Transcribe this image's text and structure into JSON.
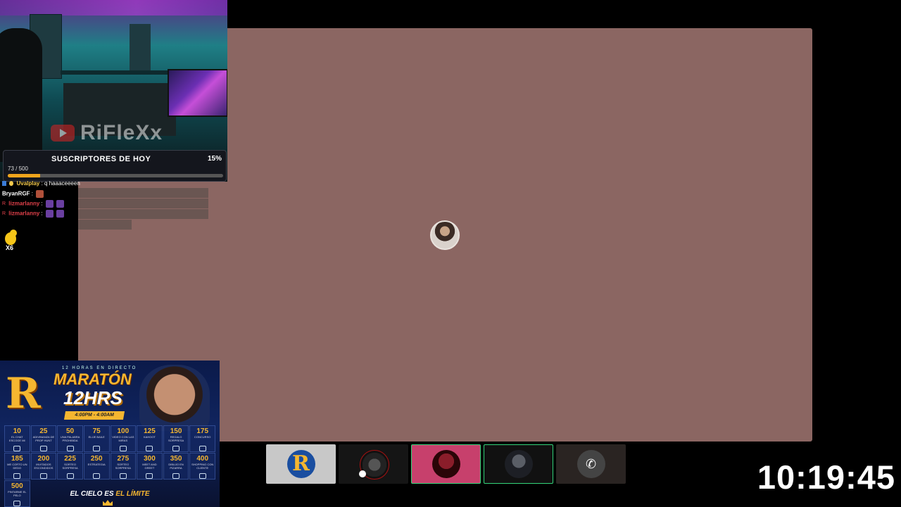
{
  "webcam": {
    "channel_name": "RiFleXx"
  },
  "goal": {
    "title": "SUSCRIPTORES DE HOY",
    "percent": "15%",
    "count": "73 / 500",
    "progress_fraction": 0.15
  },
  "chat": {
    "lines": [
      {
        "user": "Uvalplay",
        "message": ": q haaaceeeen",
        "color": "#f2c94c"
      },
      {
        "user": "BryanRGF",
        "message": ":",
        "color": "#ffffff"
      },
      {
        "user": "lizmarlanny",
        "message": ":",
        "color": "#e0404a"
      },
      {
        "user": "lizmarlanny",
        "message": ":",
        "color": "#e0404a"
      }
    ]
  },
  "duck": {
    "count": "X6"
  },
  "poster": {
    "subtitle": "12 HORAS EN DIRECTO",
    "letter": "R",
    "title": "MARATÓN",
    "title2": "12HRS",
    "time": "4:00PM - 4:00AM",
    "footer_white": "EL CIELO ES",
    "footer_gold": "EL LÍMITE",
    "goals": [
      {
        "n": "10",
        "t": "EL CHAT ESCOGE MI COMIDA"
      },
      {
        "n": "25",
        "t": "ADIVINANZA DE PROP HUNT"
      },
      {
        "n": "50",
        "t": "UNA PALABRA PROHIBIDA"
      },
      {
        "n": "75",
        "t": "ELIJE BAILE"
      },
      {
        "n": "100",
        "t": "VIDEO CON LAS MIRAS"
      },
      {
        "n": "125",
        "t": "KAHOOT"
      },
      {
        "n": "150",
        "t": "REGALO SORPRESA"
      },
      {
        "n": "175",
        "t": "CONCURSO"
      },
      {
        "n": "185",
        "t": "ME CORTO UN DEDO"
      },
      {
        "n": "200",
        "t": "INVITADOS ESCONDIDOS"
      },
      {
        "n": "225",
        "t": "SORTEO SORPRESA"
      },
      {
        "n": "250",
        "t": "ESTRATEGIA"
      },
      {
        "n": "275",
        "t": "SORTEO SORPRESA"
      },
      {
        "n": "300",
        "t": "MEET AND GREET"
      },
      {
        "n": "350",
        "t": "DIBUJO EN PIZARRA"
      },
      {
        "n": "400",
        "t": "SHOPPING CON CLIENTE"
      },
      {
        "n": "500",
        "t": "PINTARME EL PELO"
      }
    ]
  },
  "clock": "10:19:45"
}
